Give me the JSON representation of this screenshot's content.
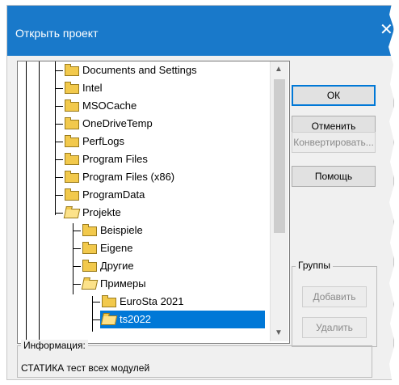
{
  "window": {
    "title": "Открыть проект",
    "close_glyph": "✕"
  },
  "tree": {
    "items": [
      {
        "label": "Documents and Settings",
        "level": 2
      },
      {
        "label": "Intel",
        "level": 2
      },
      {
        "label": "MSOCache",
        "level": 2
      },
      {
        "label": "OneDriveTemp",
        "level": 2
      },
      {
        "label": "PerfLogs",
        "level": 2
      },
      {
        "label": "Program Files",
        "level": 2
      },
      {
        "label": "Program Files (x86)",
        "level": 2
      },
      {
        "label": "ProgramData",
        "level": 2
      },
      {
        "label": "Projekte",
        "level": 2,
        "open": true
      },
      {
        "label": "Beispiele",
        "level": 3
      },
      {
        "label": "Eigene",
        "level": 3
      },
      {
        "label": "Другие",
        "level": 3
      },
      {
        "label": "Примеры",
        "level": 3,
        "open": true
      },
      {
        "label": "EuroSta 2021",
        "level": 4
      },
      {
        "label": "ts2022",
        "level": 4,
        "open": true,
        "selected": true
      }
    ]
  },
  "buttons": {
    "ok": "ОК",
    "cancel": "Отменить",
    "convert": "Конвертировать...",
    "help": "Помощь",
    "add": "Добавить",
    "remove": "Удалить"
  },
  "groups": {
    "label": "Группы"
  },
  "info": {
    "label": "Информация:",
    "text": "СТАТИКА тест всех модулей"
  },
  "colors": {
    "titlebar": "#1979ca",
    "selection": "#0078d7",
    "folder": "#f2c94c"
  }
}
